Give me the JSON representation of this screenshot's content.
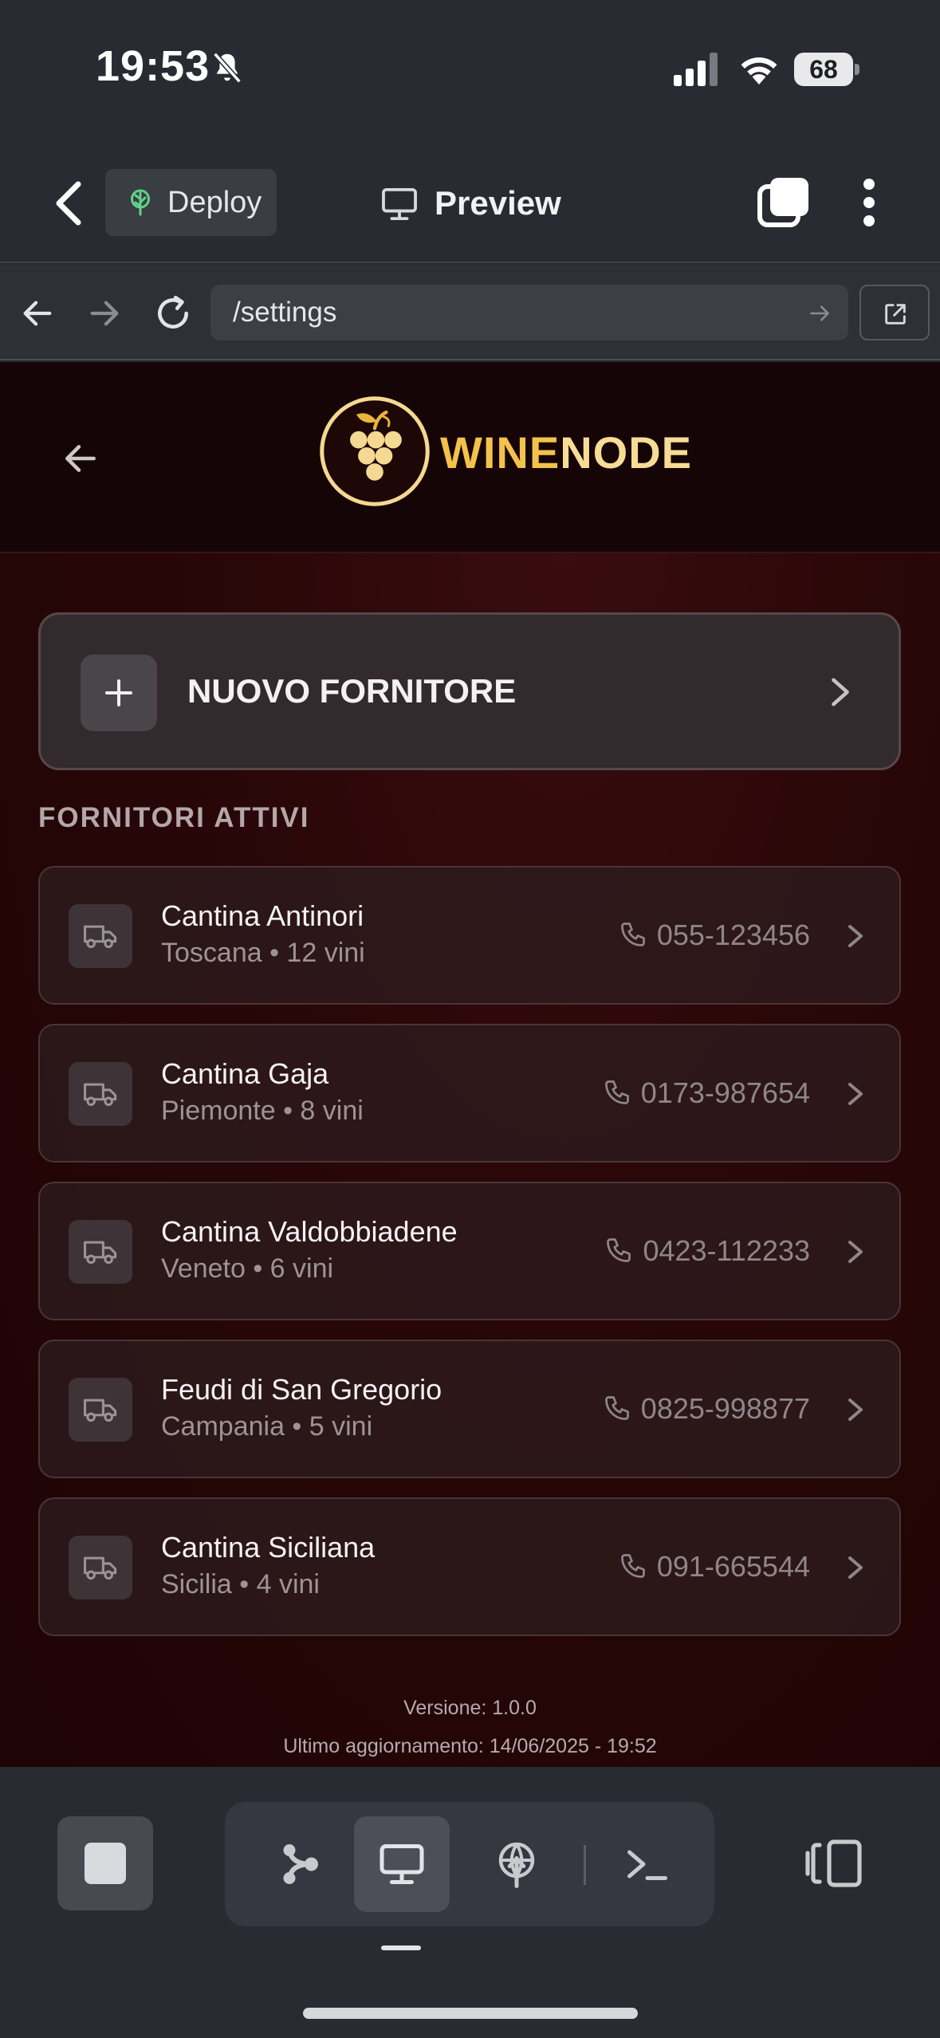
{
  "status_bar": {
    "time": "19:53",
    "battery": "68"
  },
  "app_bar": {
    "deploy_label": "Deploy",
    "preview_label": "Preview"
  },
  "browser": {
    "url": "/settings"
  },
  "site": {
    "brand_part1": "WINE",
    "brand_part2": "NODE"
  },
  "new_supplier": {
    "label": "NUOVO FORNITORE"
  },
  "section": {
    "title": "FORNITORI ATTIVI"
  },
  "suppliers": [
    {
      "name": "Cantina Antinori",
      "meta": "Toscana • 12 vini",
      "phone": "055-123456"
    },
    {
      "name": "Cantina Gaja",
      "meta": "Piemonte • 8 vini",
      "phone": "0173-987654"
    },
    {
      "name": "Cantina Valdobbiadene",
      "meta": "Veneto • 6 vini",
      "phone": "0423-112233"
    },
    {
      "name": "Feudi di San Gregorio",
      "meta": "Campania • 5 vini",
      "phone": "0825-998877"
    },
    {
      "name": "Cantina Siciliana",
      "meta": "Sicilia • 4 vini",
      "phone": "091-665544"
    }
  ],
  "footer": {
    "version": "Versione: 1.0.0",
    "updated": "Ultimo aggiornamento: 14/06/2025 - 19:52"
  },
  "colors": {
    "brand_gold": "#f2c24a",
    "brand_light": "#f7dc96",
    "page_bg": "#2a0708",
    "chrome_bg": "#282b31"
  }
}
